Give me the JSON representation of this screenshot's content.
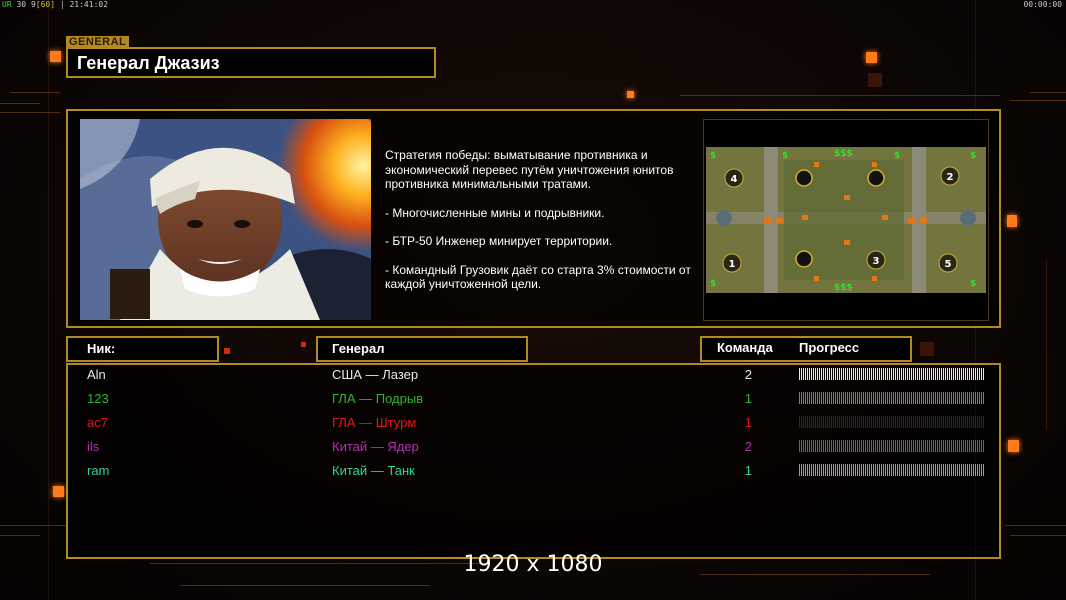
{
  "hud": {
    "left_a": "UR",
    "left_b": "30",
    "left_c": "9",
    "left_d": "[60]",
    "left_time": "21:41:02",
    "right_time": "00:00:00"
  },
  "general_tag": "GENERAL",
  "title": "Генерал Джазиз",
  "strategy": {
    "lines": [
      "Стратегия победы: выматывание противника и экономический перевес путём уничтожения юнитов противника минимальными тратами.",
      "- Многочисленные мины и подрывники.",
      "- БТР-50 Инженер минирует территории.",
      "- Командный Грузовик даёт со старта 3% стоимости от каждой уничтоженной цели."
    ]
  },
  "minimap": {
    "money_labels": [
      "$$$",
      "$$$",
      "$",
      "$",
      "$",
      "$",
      "$",
      "$"
    ],
    "spawn_numbers": [
      "4",
      "2",
      "1",
      "3",
      "5"
    ]
  },
  "table": {
    "nick_header": "Ник:",
    "general_header": "Генерал",
    "team_header": "Команда",
    "progress_header": "Прогресс",
    "players": [
      {
        "nick": "Aln",
        "general": "США — Лазер",
        "team": "2",
        "color": "#e8e8e8",
        "progress": 1.0
      },
      {
        "nick": "123",
        "general": "ГЛА — Подрыв",
        "team": "1",
        "color": "#2fb52f",
        "progress": 1.0
      },
      {
        "nick": "ac7",
        "general": "ГЛА — Штурм",
        "team": "1",
        "color": "#e01818",
        "progress": 1.0
      },
      {
        "nick": "ils",
        "general": "Китай — Ядер",
        "team": "2",
        "color": "#b52fb5",
        "progress": 1.0
      },
      {
        "nick": "ram",
        "general": "Китай — Танк",
        "team": "1",
        "color": "#2fd49a",
        "progress": 1.0
      }
    ]
  },
  "resolution_text": "1920 x 1080",
  "colors": {
    "accent_gold": "#b38a1e",
    "accent_orange": "#ff7a1a",
    "bar_dark": "#2a2a2a"
  }
}
